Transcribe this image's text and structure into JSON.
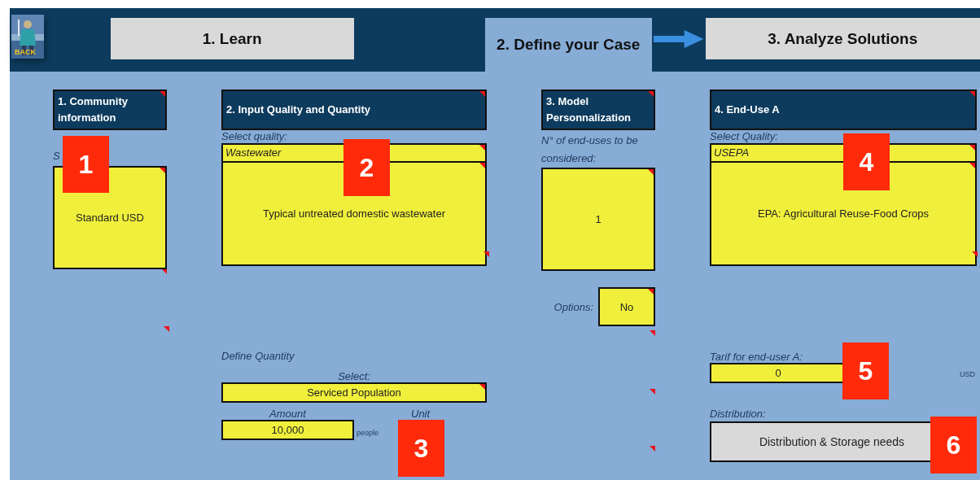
{
  "back_button": {
    "label": "BACK"
  },
  "tabs": [
    {
      "label": "1. Learn",
      "selected": false
    },
    {
      "label": "2. Define your Case",
      "selected": true
    },
    {
      "label": "3. Analyze Solutions",
      "selected": false
    }
  ],
  "sections": [
    {
      "kind": "community",
      "title": "1. Community information",
      "label": "S",
      "value": "Standard USD",
      "callout": "1"
    },
    {
      "kind": "input",
      "title": "2. Input Quality and Quantity",
      "quality_label": "Select quality:",
      "quality": "Wastewater",
      "description": "Typical untreated domestic wastewater",
      "callout": "2",
      "quantity_heading": "Define Quantity",
      "select_label": "Select:",
      "select_value": "Serviced Population",
      "amount_label": "Amount",
      "unit_label": "Unit",
      "amount": "10,000",
      "unit": "people",
      "quantity_callout": "3"
    },
    {
      "kind": "model",
      "title": "3. Model Personnalization",
      "prompt": "N° of end-uses to be considered:",
      "value": "1",
      "options_label": "Options:",
      "options_value": "No"
    },
    {
      "kind": "enduse",
      "title": "4. End-Use A",
      "quality_label": "Select Quality:",
      "quality": "USEPA",
      "description": "EPA: Agricultural Reuse-Food Crops",
      "callout": "4",
      "tarif_label": "Tarif for end-user A:",
      "tarif": "0",
      "tarif_callout": "5",
      "currency": "USD",
      "distribution_label": "Distribution:",
      "distribution_button": "Distribution & Storage needs",
      "distribution_callout": "6"
    }
  ]
}
